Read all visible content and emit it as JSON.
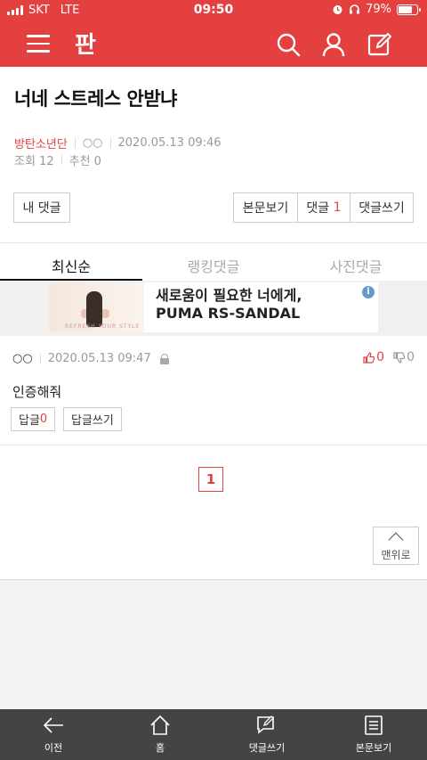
{
  "status": {
    "carrier": "SKT",
    "network": "LTE",
    "time": "09:50",
    "battery": "79%",
    "battery_level": 0.79
  },
  "header": {
    "logo": "판",
    "icons": [
      "menu-icon",
      "search-icon",
      "user-icon",
      "write-icon"
    ]
  },
  "post": {
    "title": "너네 스트레스 안받냐",
    "author": "방탄소년단",
    "nickname": "○○",
    "datetime": "2020.05.13 09:46",
    "views_label": "조회 12",
    "recommend_label": "추천 0"
  },
  "buttons": {
    "my_comments": "내 댓글",
    "view_post": "본문보기",
    "comments_label": "댓글",
    "comments_count": "1",
    "write_comment": "댓글쓰기"
  },
  "tabs": [
    {
      "label": "최신순",
      "active": true
    },
    {
      "label": "랭킹댓글",
      "active": false
    },
    {
      "label": "사진댓글",
      "active": false
    }
  ],
  "ad": {
    "text": "새로움이 필요한 너에게, PUMA RS-SANDAL",
    "image_caption": "REFRESH YOUR STYLE",
    "info": "i"
  },
  "comment": {
    "author": "○○",
    "datetime": "2020.05.13 09:47",
    "text": "인증해줘",
    "likes": "0",
    "dislikes": "0",
    "reply_label": "답글",
    "reply_count": "0",
    "write_reply": "답글쓰기"
  },
  "pagination": {
    "current": "1"
  },
  "to_top": "맨위로",
  "bottom_nav": [
    {
      "label": "이전",
      "icon": "back-arrow-icon"
    },
    {
      "label": "홈",
      "icon": "home-icon"
    },
    {
      "label": "댓글쓰기",
      "icon": "comment-write-icon"
    },
    {
      "label": "본문보기",
      "icon": "document-icon"
    }
  ],
  "colors": {
    "brand": "#e3403f",
    "bottom_bar": "#444444"
  }
}
